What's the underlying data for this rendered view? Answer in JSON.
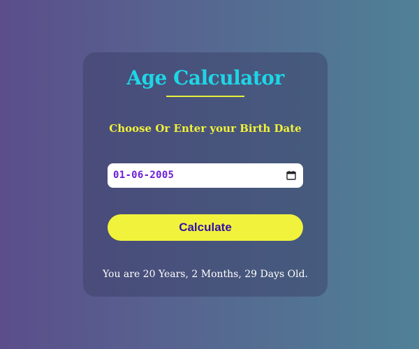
{
  "app": {
    "title": "Age Calculator",
    "prompt": "Choose Or Enter your Birth Date"
  },
  "birth_date": {
    "value": "01-06-2005",
    "icon": "calendar-icon"
  },
  "actions": {
    "calculate_label": "Calculate"
  },
  "result": {
    "text": "You are 20 Years, 2 Months, 29 Days Old."
  },
  "colors": {
    "title": "#1ed6e6",
    "accent_yellow": "#f1f23c",
    "button_text": "#3310a8",
    "date_text": "#6a1ed8"
  }
}
